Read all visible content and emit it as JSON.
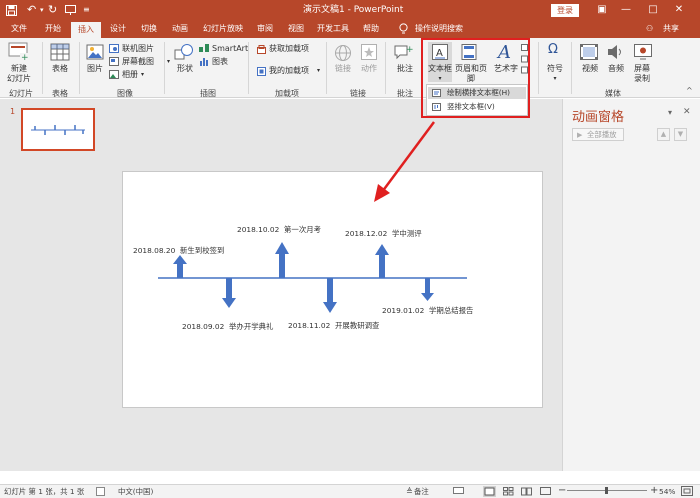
{
  "title_bar": {
    "doc_title": "演示文稿1 - PowerPoint",
    "login_label": "登录",
    "minimize": "—",
    "restore": "□",
    "close": "✕",
    "quick_access": [
      "save",
      "undo",
      "redo",
      "present-from-start",
      "customize"
    ]
  },
  "tabs": [
    "文件",
    "开始",
    "插入",
    "设计",
    "切换",
    "动画",
    "幻灯片放映",
    "审阅",
    "视图",
    "开发工具",
    "帮助"
  ],
  "active_tab": "插入",
  "tell_me": "操作说明搜索",
  "share_label": "共享",
  "ribbon": {
    "new_slide": "新建\n幻灯片",
    "table": "表格",
    "images": "图片",
    "online_pictures": "联机图片",
    "screenshot": "屏幕截图",
    "photo_album": "相册",
    "shapes": "形状",
    "smartart": "SmartArt",
    "chart": "图表",
    "get_addins": "获取加载项",
    "my_addins": "我的加载项",
    "link": "链接",
    "action": "动作",
    "comment": "批注",
    "textbox": "文本框",
    "header_footer": "页眉和页脚",
    "wordart": "艺术字",
    "symbol": "符号",
    "video": "视频",
    "audio": "音频",
    "screen_recording": "屏幕\n录制",
    "groups": {
      "slides": "幻灯片",
      "tables": "表格",
      "images": "图像",
      "illustrations": "插图",
      "addins": "加载项",
      "links": "链接",
      "comments": "批注",
      "media": "媒体"
    }
  },
  "textbox_menu": {
    "horizontal": "绘制横排文本框(H)",
    "vertical": "竖排文本框(V)"
  },
  "thumbnail": {
    "number": "1"
  },
  "slide": {
    "events": [
      {
        "date": "2018.08.20",
        "text": "新生到校签到",
        "dir": "up"
      },
      {
        "date": "2018.09.02",
        "text": "举办开学典礼",
        "dir": "down"
      },
      {
        "date": "2018.10.02",
        "text": "第一次月考",
        "dir": "up"
      },
      {
        "date": "2018.11.02",
        "text": "开展教研调查",
        "dir": "down"
      },
      {
        "date": "2018.12.02",
        "text": "学中测评",
        "dir": "up"
      },
      {
        "date": "2019.01.02",
        "text": "学期总结报告",
        "dir": "down"
      }
    ]
  },
  "animation_pane": {
    "title": "动画窗格",
    "play_all": "全部播放",
    "close": "✕",
    "dropdown": "▾"
  },
  "status": {
    "slide_info": "幻灯片 第 1 张，共 1 张",
    "language": "中文(中国)",
    "notes": "备注",
    "zoom": "54%"
  },
  "colors": {
    "accent": "#b7472a",
    "arrow": "#4472c4",
    "highlight": "#e02020"
  }
}
